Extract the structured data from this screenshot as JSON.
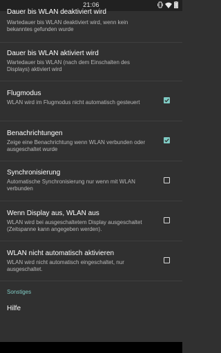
{
  "status_bar": {
    "time": "21:06",
    "icons": [
      "vibrate-icon",
      "wifi-icon",
      "battery-icon"
    ]
  },
  "settings": [
    {
      "title": "Dauer bis WLAN deaktiviert wird",
      "summary": "Wartedauer bis WLAN deaktiviert wird, wenn kein bekanntes gefunden wurde",
      "checkbox": null
    },
    {
      "title": "Dauer bis WLAN aktiviert wird",
      "summary": "Wartedauer bis WLAN (nach dem Einschalten des Displays) aktiviert wird",
      "checkbox": null
    },
    {
      "title": "Flugmodus",
      "summary": "WLAN wird im Flugmodus nicht automatisch gesteuert",
      "checkbox": true
    },
    {
      "title": "Benachrichtungen",
      "summary": "Zeige eine Benachrichtung wenn WLAN verbunden oder ausgeschaltet wurde",
      "checkbox": true
    },
    {
      "title": "Synchronisierung",
      "summary": "Automatische Synchronisierung nur wenn mit WLAN verbunden",
      "checkbox": false
    },
    {
      "title": "Wenn Display aus, WLAN aus",
      "summary": "WLAN wird bei ausgeschaltetem Display ausgeschaltet (Zeitspanne kann angegeben werden).",
      "checkbox": false
    },
    {
      "title": "WLAN nicht automatisch aktivieren",
      "summary": "WLAN wird nicht automatisch eingeschaltet, nur ausgeschaltet.",
      "checkbox": false
    }
  ],
  "section_header": "Sonstiges",
  "help_item": "Hilfe",
  "colors": {
    "background": "#303030",
    "accent": "#80cbc4",
    "title": "#ffffff",
    "summary": "#b9b9b9"
  }
}
